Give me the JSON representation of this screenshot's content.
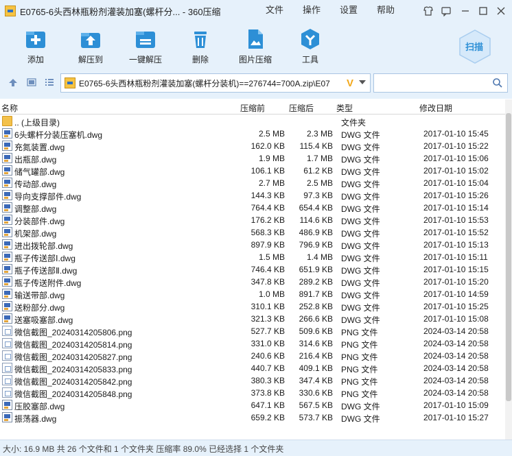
{
  "window": {
    "title": "E0765-6头西林瓶粉剂灌装加塞(螺杆分...  - 360压缩"
  },
  "menu": {
    "items": [
      "文件",
      "操作",
      "设置",
      "帮助"
    ]
  },
  "toolbar": {
    "tools": [
      {
        "label": "添加",
        "icon": "add-icon"
      },
      {
        "label": "解压到",
        "icon": "extract-to-icon"
      },
      {
        "label": "一键解压",
        "icon": "one-click-extract-icon"
      },
      {
        "label": "删除",
        "icon": "delete-icon"
      },
      {
        "label": "图片压缩",
        "icon": "image-compress-icon"
      },
      {
        "label": "工具",
        "icon": "tools-icon"
      }
    ],
    "scan_label": "扫描"
  },
  "address": {
    "path": "E0765-6头西林瓶粉剂灌装加塞(螺杆分装机)==276744=700A.zip\\E07",
    "search_placeholder": ""
  },
  "columns": {
    "name": "名称",
    "compressed": "压缩前",
    "after": "压缩后",
    "type": "类型",
    "modified": "修改日期"
  },
  "files": [
    {
      "name": ".. (上级目录)",
      "before": "",
      "after": "",
      "type": "文件夹",
      "date": "",
      "kind": "folder"
    },
    {
      "name": "6头螺杆分装压塞机.dwg",
      "before": "2.5 MB",
      "after": "2.3 MB",
      "type": "DWG 文件",
      "date": "2017-01-10 15:45",
      "kind": "dwg"
    },
    {
      "name": "充氮装置.dwg",
      "before": "162.0 KB",
      "after": "115.4 KB",
      "type": "DWG 文件",
      "date": "2017-01-10 15:22",
      "kind": "dwg"
    },
    {
      "name": "出瓶部.dwg",
      "before": "1.9 MB",
      "after": "1.7 MB",
      "type": "DWG 文件",
      "date": "2017-01-10 15:06",
      "kind": "dwg"
    },
    {
      "name": "储气罐部.dwg",
      "before": "106.1 KB",
      "after": "61.2 KB",
      "type": "DWG 文件",
      "date": "2017-01-10 15:02",
      "kind": "dwg"
    },
    {
      "name": "传动部.dwg",
      "before": "2.7 MB",
      "after": "2.5 MB",
      "type": "DWG 文件",
      "date": "2017-01-10 15:04",
      "kind": "dwg"
    },
    {
      "name": "导向支撑部件.dwg",
      "before": "144.3 KB",
      "after": "97.3 KB",
      "type": "DWG 文件",
      "date": "2017-01-10 15:26",
      "kind": "dwg"
    },
    {
      "name": "调整部.dwg",
      "before": "764.4 KB",
      "after": "654.4 KB",
      "type": "DWG 文件",
      "date": "2017-01-10 15:14",
      "kind": "dwg"
    },
    {
      "name": "分装部件.dwg",
      "before": "176.2 KB",
      "after": "114.6 KB",
      "type": "DWG 文件",
      "date": "2017-01-10 15:53",
      "kind": "dwg"
    },
    {
      "name": "机架部.dwg",
      "before": "568.3 KB",
      "after": "486.9 KB",
      "type": "DWG 文件",
      "date": "2017-01-10 15:52",
      "kind": "dwg"
    },
    {
      "name": "进出拨轮部.dwg",
      "before": "897.9 KB",
      "after": "796.9 KB",
      "type": "DWG 文件",
      "date": "2017-01-10 15:13",
      "kind": "dwg"
    },
    {
      "name": "瓶子传送部Ⅰ.dwg",
      "before": "1.5 MB",
      "after": "1.4 MB",
      "type": "DWG 文件",
      "date": "2017-01-10 15:11",
      "kind": "dwg"
    },
    {
      "name": "瓶子传送部Ⅱ.dwg",
      "before": "746.4 KB",
      "after": "651.9 KB",
      "type": "DWG 文件",
      "date": "2017-01-10 15:15",
      "kind": "dwg"
    },
    {
      "name": "瓶子传送附件.dwg",
      "before": "347.8 KB",
      "after": "289.2 KB",
      "type": "DWG 文件",
      "date": "2017-01-10 15:20",
      "kind": "dwg"
    },
    {
      "name": "输送带部.dwg",
      "before": "1.0 MB",
      "after": "891.7 KB",
      "type": "DWG 文件",
      "date": "2017-01-10 14:59",
      "kind": "dwg"
    },
    {
      "name": "送粉部分.dwg",
      "before": "310.1 KB",
      "after": "252.8 KB",
      "type": "DWG 文件",
      "date": "2017-01-10 15:25",
      "kind": "dwg"
    },
    {
      "name": "送塞吸塞部.dwg",
      "before": "321.3 KB",
      "after": "266.6 KB",
      "type": "DWG 文件",
      "date": "2017-01-10 15:08",
      "kind": "dwg"
    },
    {
      "name": "微信截图_20240314205806.png",
      "before": "527.7 KB",
      "after": "509.6 KB",
      "type": "PNG 文件",
      "date": "2024-03-14 20:58",
      "kind": "png"
    },
    {
      "name": "微信截图_20240314205814.png",
      "before": "331.0 KB",
      "after": "314.6 KB",
      "type": "PNG 文件",
      "date": "2024-03-14 20:58",
      "kind": "png"
    },
    {
      "name": "微信截图_20240314205827.png",
      "before": "240.6 KB",
      "after": "216.4 KB",
      "type": "PNG 文件",
      "date": "2024-03-14 20:58",
      "kind": "png"
    },
    {
      "name": "微信截图_20240314205833.png",
      "before": "440.7 KB",
      "after": "409.1 KB",
      "type": "PNG 文件",
      "date": "2024-03-14 20:58",
      "kind": "png"
    },
    {
      "name": "微信截图_20240314205842.png",
      "before": "380.3 KB",
      "after": "347.4 KB",
      "type": "PNG 文件",
      "date": "2024-03-14 20:58",
      "kind": "png"
    },
    {
      "name": "微信截图_20240314205848.png",
      "before": "373.8 KB",
      "after": "330.6 KB",
      "type": "PNG 文件",
      "date": "2024-03-14 20:58",
      "kind": "png"
    },
    {
      "name": "压胶塞部.dwg",
      "before": "647.1 KB",
      "after": "567.5 KB",
      "type": "DWG 文件",
      "date": "2017-01-10 15:09",
      "kind": "dwg"
    },
    {
      "name": "振荡器.dwg",
      "before": "659.2 KB",
      "after": "573.7 KB",
      "type": "DWG 文件",
      "date": "2017-01-10 15:27",
      "kind": "dwg"
    }
  ],
  "status": {
    "text": "大小: 16.9 MB 共 26 个文件和 1 个文件夹 压缩率 89.0% 已经选择 1 个文件夹"
  },
  "colors": {
    "chrome": "#e6f1fb",
    "accent": "#2d8fd6"
  }
}
